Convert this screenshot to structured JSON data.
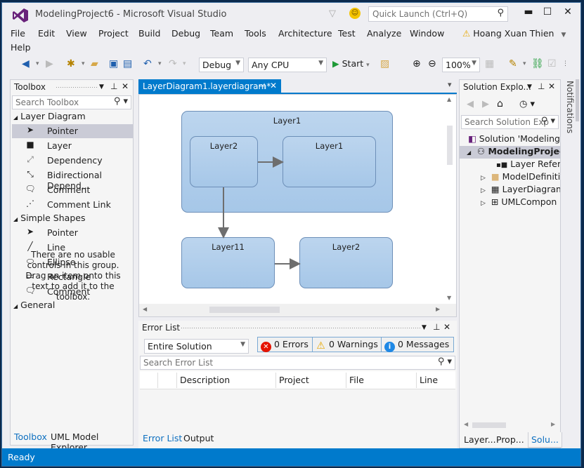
{
  "window": {
    "title": "ModelingProject6 - Microsoft Visual Studio",
    "quick_launch_placeholder": "Quick Launch (Ctrl+Q)",
    "controls": {
      "minimize": "▬",
      "maximize": "☐",
      "close": "✕"
    }
  },
  "menu": {
    "items": [
      "File",
      "Edit",
      "View",
      "Project",
      "Build",
      "Debug",
      "Team",
      "Tools",
      "Architecture",
      "Test",
      "Analyze",
      "Window",
      "Help"
    ],
    "user": "Hoang Xuan Thien"
  },
  "toolbar": {
    "config": "Debug",
    "platform": "Any CPU",
    "start_label": "Start",
    "zoom": "100%"
  },
  "toolbox": {
    "title": "Toolbox",
    "search_placeholder": "Search Toolbox",
    "groups": [
      {
        "label": "Layer Diagram",
        "items": [
          {
            "label": "Pointer",
            "icon": "pointer-icon",
            "selected": true
          },
          {
            "label": "Layer",
            "icon": "layer-icon"
          },
          {
            "label": "Dependency",
            "icon": "dependency-icon"
          },
          {
            "label": "Bidirectional Depend...",
            "icon": "bidirectional-icon"
          },
          {
            "label": "Comment",
            "icon": "comment-icon"
          },
          {
            "label": "Comment Link",
            "icon": "comment-link-icon"
          }
        ]
      },
      {
        "label": "Simple Shapes",
        "items": [
          {
            "label": "Pointer",
            "icon": "pointer-icon"
          },
          {
            "label": "Line",
            "icon": "line-icon"
          },
          {
            "label": "Ellipse",
            "icon": "ellipse-icon"
          },
          {
            "label": "Rectangle",
            "icon": "rectangle-icon"
          },
          {
            "label": "Comment",
            "icon": "comment-icon"
          }
        ]
      },
      {
        "label": "General",
        "items": []
      }
    ],
    "empty_message": "There are no usable controls in this group. Drag an item onto this text to add it to the toolbox.",
    "bottom_tabs": [
      "Toolbox",
      "UML Model Explorer"
    ]
  },
  "editor": {
    "tab_label": "LayerDiagram1.layerdiagram*",
    "layers": {
      "outer": "Layer1",
      "inner_left": "Layer2",
      "inner_right": "Layer1",
      "bottom_left": "Layer11",
      "bottom_right": "Layer2"
    }
  },
  "error_list": {
    "title": "Error List",
    "scope": "Entire Solution",
    "errors": "0 Errors",
    "warnings": "0 Warnings",
    "messages": "0 Messages",
    "search_placeholder": "Search Error List",
    "columns": [
      "Description",
      "Project",
      "File",
      "Line"
    ],
    "bottom_tabs": [
      "Error List",
      "Output"
    ]
  },
  "solution_explorer": {
    "title": "Solution Explo...",
    "search_placeholder": "Search Solution Exp",
    "items": [
      {
        "label": "Solution 'ModelingP"
      },
      {
        "label": "ModelingProject"
      },
      {
        "label": "Layer Referen"
      },
      {
        "label": "ModelDefiniti"
      },
      {
        "label": "LayerDiagram"
      },
      {
        "label": "UMLCompon"
      }
    ],
    "bottom_tabs": [
      "Layer...",
      "Prop...",
      "Solu..."
    ]
  },
  "notifications_label": "Notifications",
  "status": {
    "text": "Ready"
  }
}
